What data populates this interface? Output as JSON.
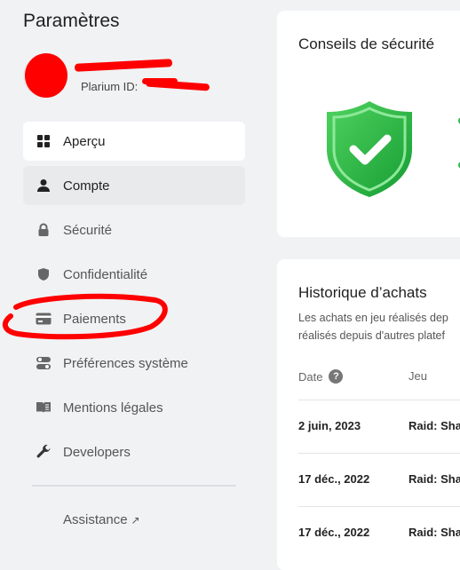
{
  "sidebar": {
    "title": "Paramètres",
    "plarium_id_label": "Plarium ID:",
    "items": [
      {
        "label": "Aperçu",
        "icon": "grid-icon"
      },
      {
        "label": "Compte",
        "icon": "person-icon"
      },
      {
        "label": "Sécurité",
        "icon": "lock-icon"
      },
      {
        "label": "Confidentialité",
        "icon": "shield-icon"
      },
      {
        "label": "Paiements",
        "icon": "credit-card-icon"
      },
      {
        "label": "Préférences système",
        "icon": "toggles-icon"
      },
      {
        "label": "Mentions légales",
        "icon": "book-icon"
      },
      {
        "label": "Developers",
        "icon": "wrench-icon"
      }
    ],
    "assistance": "Assistance",
    "assistance_arrow": "↗"
  },
  "security_card": {
    "title": "Conseils de sécurité",
    "icon": "shield-check-icon"
  },
  "purchases": {
    "title": "Historique d’achats",
    "desc_line1": "Les achats en jeu réalisés dep",
    "desc_line2": "réalisés depuis d'autres platef",
    "col_date": "Date",
    "col_help": "?",
    "col_game": "Jeu",
    "rows": [
      {
        "date": "2 juin, 2023",
        "game": "Raid: Sha"
      },
      {
        "date": "17 déc., 2022",
        "game": "Raid: Sha"
      },
      {
        "date": "17 déc., 2022",
        "game": "Raid: Sha"
      }
    ]
  },
  "colors": {
    "accent_green": "#2ebd48",
    "annotation_red": "#ff0000"
  }
}
